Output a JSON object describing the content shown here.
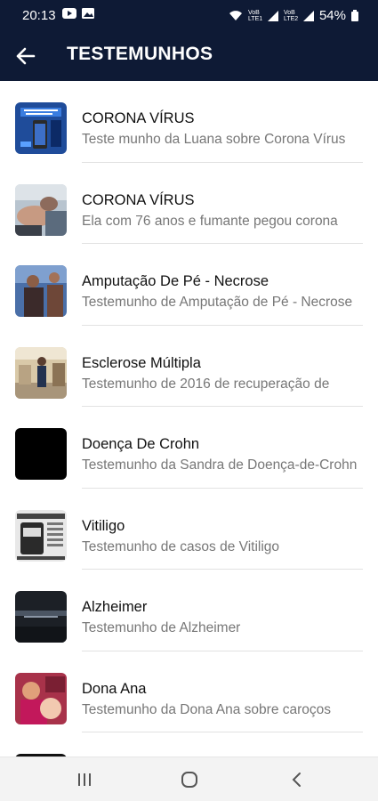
{
  "status_bar": {
    "time": "20:13",
    "battery": "54%",
    "net1": "VoB LTE1",
    "net2": "VoB LTE2"
  },
  "header": {
    "title": "TESTEMUNHOS"
  },
  "items": [
    {
      "title": "CORONA VÍRUS",
      "subtitle": "Teste munho da Luana sobre Corona Vírus"
    },
    {
      "title": "CORONA VÍRUS",
      "subtitle": "Ela com 76 anos e fumante pegou corona"
    },
    {
      "title": "Amputação De Pé - Necrose",
      "subtitle": "Testemunho de Amputação de Pé - Necrose"
    },
    {
      "title": "Esclerose Múltipla",
      "subtitle": "Testemunho de 2016 de recuperação de"
    },
    {
      "title": "Doença De Crohn",
      "subtitle": "Testemunho da Sandra de Doença-de-Crohn"
    },
    {
      "title": "Vitiligo",
      "subtitle": "Testemunho de casos de Vitiligo"
    },
    {
      "title": "Alzheimer",
      "subtitle": "Testemunho de Alzheimer"
    },
    {
      "title": "Dona Ana",
      "subtitle": "Testemunho da Dona Ana sobre caroços"
    }
  ],
  "colors": {
    "header_bg": "#0e1a35",
    "title_text": "#111111",
    "subtitle_text": "#777777",
    "nav_bg": "#f3f3f3"
  },
  "icons": {
    "back": "arrow-left",
    "nav_recent": "recent-apps",
    "nav_home": "home",
    "nav_back": "back-chevron"
  }
}
